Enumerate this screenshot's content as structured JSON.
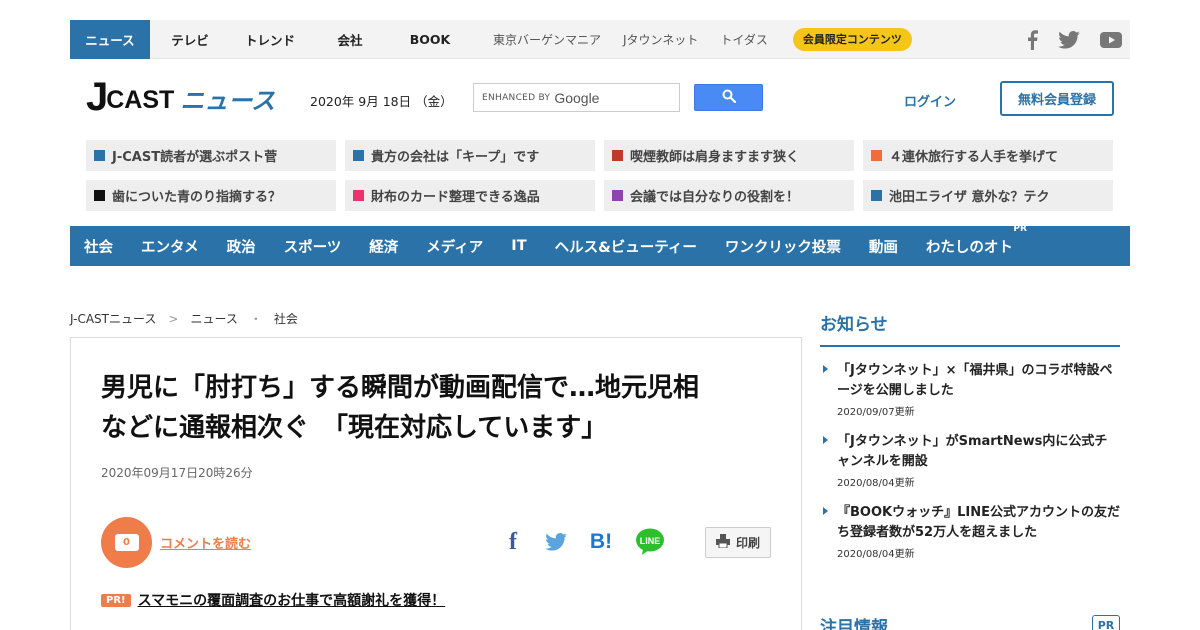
{
  "topnav": {
    "items": [
      {
        "label": "ニュース",
        "active": true
      },
      {
        "label": "テレビ"
      },
      {
        "label": "トレンド"
      },
      {
        "label": "会社"
      },
      {
        "label": "BOOK"
      }
    ],
    "sub_items": [
      "東京バーゲンマニア",
      "Jタウンネット",
      "トイダス"
    ],
    "member_badge": "会員限定コンテンツ",
    "social_icons": [
      "facebook-icon",
      "twitter-icon",
      "youtube-icon"
    ]
  },
  "header": {
    "logo_j": "J",
    "logo_cast": "CAST",
    "logo_news": "ニュース",
    "date": "2020年 9月 18日 （金）",
    "search_placeholder_prefix": "ENHANCED BY",
    "search_placeholder_brand": "Google",
    "login": "ログイン",
    "register": "無料会員登録"
  },
  "quick_links": [
    {
      "label": "J-CAST読者が選ぶポスト菅",
      "color": "#2a72a8"
    },
    {
      "label": "貴方の会社は「キープ」です",
      "color": "#2a72a8"
    },
    {
      "label": "喫煙教師は肩身ますます狭く",
      "color": "#c0392b"
    },
    {
      "label": "４連休旅行する人手を挙げて",
      "color": "#f26b3a"
    },
    {
      "label": "歯についた青のり指摘する？",
      "color": "#111111"
    },
    {
      "label": "財布のカード整理できる逸品",
      "color": "#e8336d"
    },
    {
      "label": "会議では自分なりの役割を！",
      "color": "#8e44ad"
    },
    {
      "label": "池田エライザ 意外な？テク",
      "color": "#2a72a8"
    }
  ],
  "categories": [
    {
      "label": "社会"
    },
    {
      "label": "エンタメ"
    },
    {
      "label": "政治"
    },
    {
      "label": "スポーツ"
    },
    {
      "label": "経済"
    },
    {
      "label": "メディア"
    },
    {
      "label": "IT"
    },
    {
      "label": "ヘルス&ビューティー"
    },
    {
      "label": "ワンクリック投票"
    },
    {
      "label": "動画"
    },
    {
      "label": "わたしのオト",
      "pr": "PR"
    }
  ],
  "breadcrumb": [
    "J-CASTニュース",
    "ニュース",
    "社会"
  ],
  "breadcrumb_separators": [
    ">",
    "・"
  ],
  "article": {
    "title_line1": "男児に「肘打ち」する瞬間が動画配信で…地元児相",
    "title_line2": "などに通報相次ぐ　「現在対応しています」",
    "date": "2020年09月17日20時26分",
    "comment_count": "0",
    "comment_link": "コメントを読む",
    "share_icons": [
      "facebook-share-icon",
      "twitter-share-icon",
      "hatena-bookmark-icon",
      "line-share-icon"
    ],
    "hatena_label": "B!",
    "line_label": "LINE",
    "fb_label": "f",
    "print_label": "印刷",
    "pr_badge": "PR!",
    "pr_text": "スマモニの覆面調査のお仕事で高額謝礼を獲得！"
  },
  "sidebar": {
    "title": "お知らせ",
    "items": [
      {
        "title": "「Jタウンネット」×「福井県」のコラボ特設ページを公開しました",
        "date": "2020/09/07更新"
      },
      {
        "title": "「Jタウンネット」がSmartNews内に公式チャンネルを開設",
        "date": "2020/08/04更新"
      },
      {
        "title": "『BOOKウォッチ』LINE公式アカウントの友だち登録者数が52万人を超えました",
        "date": "2020/08/04更新"
      }
    ],
    "title2": "注目情報",
    "pr": "PR"
  },
  "colors": {
    "brand_blue": "#2a72a8",
    "accent_orange": "#f07c4a",
    "member_yellow": "#f5c518",
    "google_blue": "#4a8af4"
  }
}
